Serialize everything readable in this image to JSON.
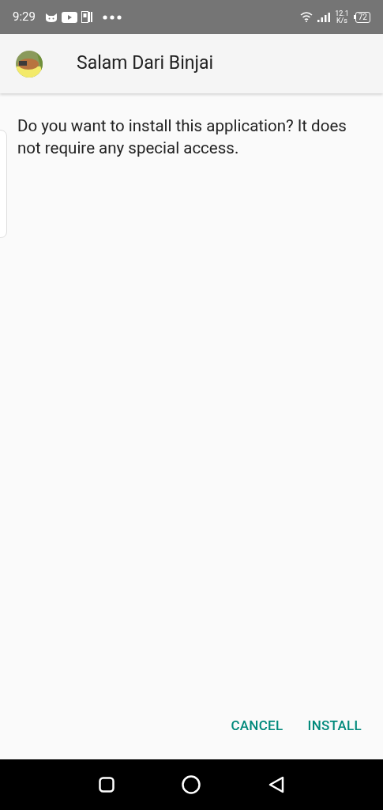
{
  "status_bar": {
    "time": "9:29",
    "speed_value": "12.1",
    "speed_unit": "K/s",
    "battery": "72"
  },
  "app_bar": {
    "title": "Salam Dari Binjai"
  },
  "message": "Do you want to install this application? It does not require any special access.",
  "buttons": [
    {
      "label": "CANCEL"
    },
    {
      "label": "INSTALL"
    }
  ]
}
